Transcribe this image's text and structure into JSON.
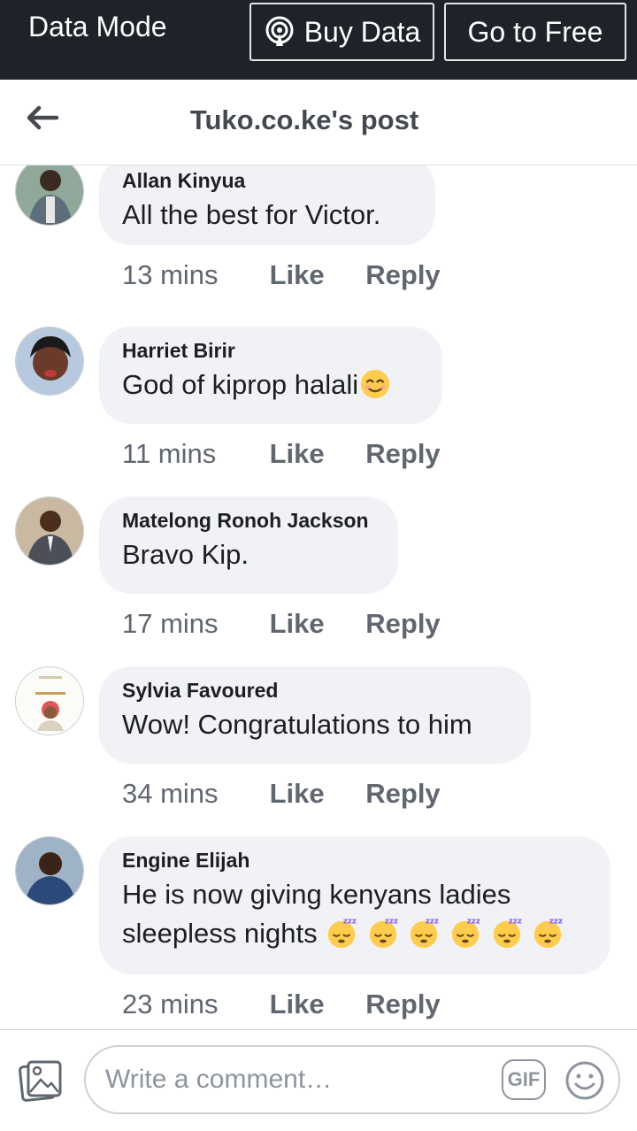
{
  "topbar": {
    "mode_label": "Data Mode",
    "buy_label": "Buy Data",
    "free_label": "Go to Free",
    "background": "#1e232a"
  },
  "header": {
    "title": "Tuko.co.ke's post",
    "back_icon": "back-arrow-icon"
  },
  "comments": [
    {
      "author": "Allan Kinyua",
      "text": "All the best for Victor.",
      "time": "13 mins",
      "like": "Like",
      "reply": "Reply"
    },
    {
      "author": "Harriet Birir",
      "text": "God of kiprop halali",
      "emoji": "smiling-face-icon",
      "time": "11 mins",
      "like": "Like",
      "reply": "Reply"
    },
    {
      "author": "Matelong Ronoh Jackson",
      "text": "Bravo Kip.",
      "time": "17 mins",
      "like": "Like",
      "reply": "Reply"
    },
    {
      "author": "Sylvia Favoured",
      "text": "Wow! Congratulations to him",
      "time": "34 mins",
      "like": "Like",
      "reply": "Reply"
    },
    {
      "author": "Engine Elijah",
      "text_line1": "He is now  giving kenyans ladies",
      "text_line2": "sleepless nights",
      "emoji": "sleeping-face-icon",
      "emoji_count": 6,
      "time": "23 mins",
      "like": "Like",
      "reply": "Reply"
    }
  ],
  "footer": {
    "placeholder": "Write a comment…",
    "gif_label": "GIF",
    "photo_icon": "photo-icon",
    "smile_icon": "smiley-icon"
  },
  "colors": {
    "bubble": "#f0f2f5",
    "meta_text": "#606770",
    "text": "#1c1e21"
  }
}
